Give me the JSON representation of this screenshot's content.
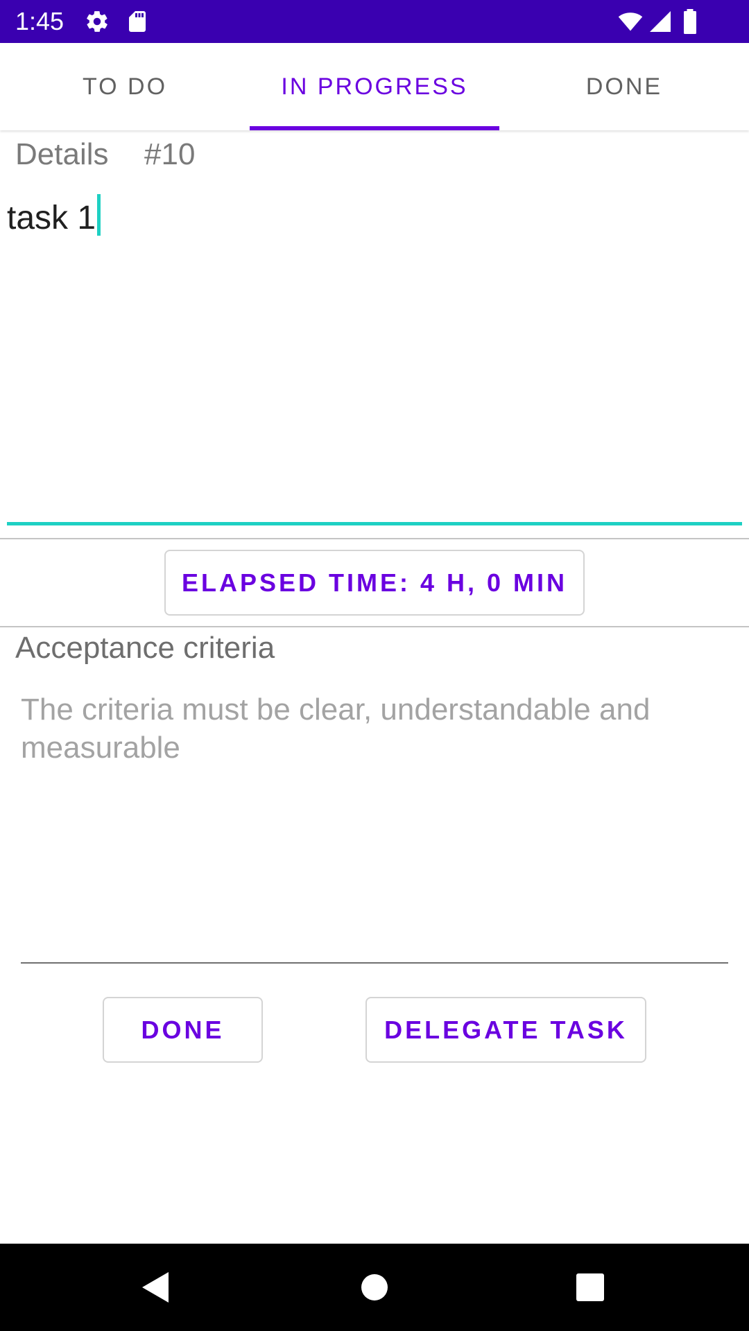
{
  "status_bar": {
    "time": "1:45",
    "background": "#3a00b0",
    "icons_left": [
      "gear-icon",
      "sd-card-icon"
    ],
    "icons_right": [
      "wifi-icon",
      "signal-icon",
      "battery-icon"
    ]
  },
  "tabs": [
    {
      "label": "TO DO",
      "active": false
    },
    {
      "label": "IN PROGRESS",
      "active": true
    },
    {
      "label": "DONE",
      "active": false
    }
  ],
  "accent_color": "#6a00e0",
  "input_accent_color": "#1ed0c3",
  "details": {
    "label": "Details",
    "number": "#10"
  },
  "task": {
    "name_value": "task 1"
  },
  "elapsed_button": {
    "label": "ELAPSED TIME: 4 H, 0 MIN"
  },
  "acceptance": {
    "label": "Acceptance criteria",
    "placeholder": "The criteria must be clear, understandable and measurable",
    "value": ""
  },
  "actions": {
    "done_label": "DONE",
    "delegate_label": "DELEGATE TASK"
  },
  "nav_bar": {
    "icons": [
      "back-icon",
      "home-icon",
      "recents-icon"
    ]
  }
}
